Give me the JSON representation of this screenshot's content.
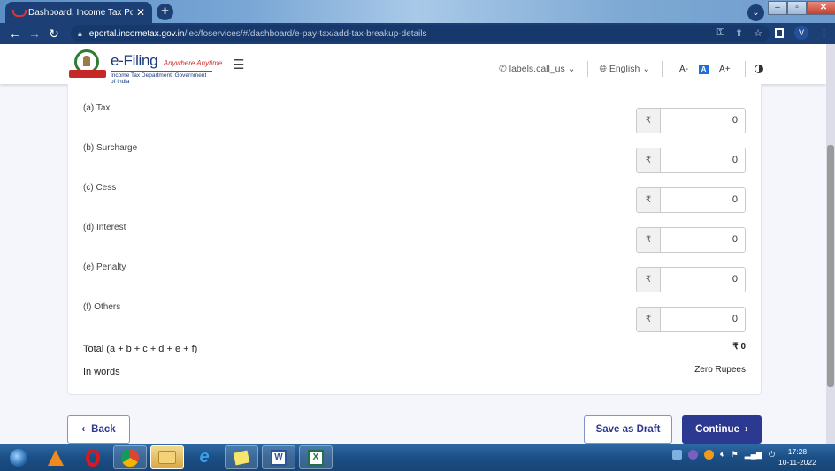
{
  "browser": {
    "tab_title": "Dashboard, Income Tax Portal, G",
    "url_host": "eportal.incometax.gov.in",
    "url_path": "/iec/foservices/#/dashboard/e-pay-tax/add-tax-breakup-details",
    "profile_initial": "V"
  },
  "header": {
    "brand": "e-Filing",
    "tagline": "Anywhere Anytime",
    "department": "Income Tax Department, Government of India",
    "call_us_label": "labels.call_us",
    "language": "English",
    "font_decrease": "A-",
    "font_normal": "A",
    "font_increase": "A+"
  },
  "form": {
    "currency_symbol": "₹",
    "rows": [
      {
        "label": "(a) Tax",
        "value": "0"
      },
      {
        "label": "(b) Surcharge",
        "value": "0"
      },
      {
        "label": "(c) Cess",
        "value": "0"
      },
      {
        "label": "(d) Interest",
        "value": "0"
      },
      {
        "label": "(e) Penalty",
        "value": "0"
      },
      {
        "label": "(f) Others",
        "value": "0"
      }
    ],
    "total_label": "Total (a + b + c + d + e + f)",
    "total_value": "₹ 0",
    "words_label": "In words",
    "words_value": "Zero Rupees"
  },
  "actions": {
    "back": "Back",
    "save_draft": "Save as Draft",
    "continue": "Continue"
  },
  "taskbar": {
    "apps": [
      "start",
      "vlc",
      "opera",
      "chrome",
      "explorer",
      "internet-explorer",
      "sticky-notes",
      "word",
      "excel"
    ],
    "time": "17:28",
    "date": "10-11-2022"
  },
  "colors": {
    "primary": "#2b3990",
    "chrome_dark": "#1c3f75"
  }
}
